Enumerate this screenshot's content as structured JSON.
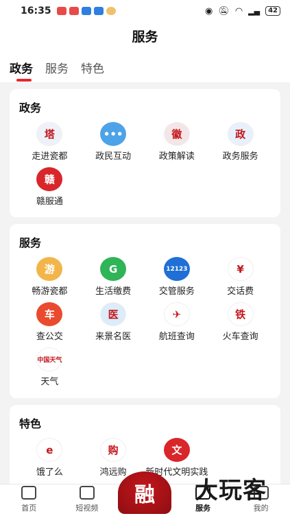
{
  "status": {
    "time": "16:35",
    "battery": "42"
  },
  "header": {
    "title": "服务"
  },
  "tabs": [
    "政务",
    "服务",
    "特色"
  ],
  "sections": {
    "gov": {
      "title": "政务",
      "items": [
        {
          "label": "走进瓷都",
          "icon": "pagoda-icon",
          "color": "#eef2f8",
          "glyph": "塔"
        },
        {
          "label": "政民互动",
          "icon": "chat-bubble-icon",
          "color": "#4ea3e8",
          "glyph": "•••"
        },
        {
          "label": "政策解读",
          "icon": "emblem-icon",
          "color": "#f4e6e6",
          "glyph": "徽"
        },
        {
          "label": "政务服务",
          "icon": "gov-service-icon",
          "color": "#e8f1fb",
          "glyph": "政"
        },
        {
          "label": "赣服通",
          "icon": "gan-fu-tong-icon",
          "color": "#d8262a",
          "glyph": "赣"
        }
      ]
    },
    "service": {
      "title": "服务",
      "items": [
        {
          "label": "畅游瓷都",
          "icon": "tower-icon",
          "color": "#f2b54a",
          "glyph": "游"
        },
        {
          "label": "生活缴费",
          "icon": "payment-icon",
          "color": "#2fb457",
          "glyph": "G"
        },
        {
          "label": "交管服务",
          "icon": "traffic-12123-icon",
          "color": "#1f6fd6",
          "glyph": "12123"
        },
        {
          "label": "交话费",
          "icon": "phone-bill-icon",
          "color": "#ffffff",
          "glyph": "¥"
        },
        {
          "label": "查公交",
          "icon": "bus-icon",
          "color": "#ea4a2e",
          "glyph": "车"
        },
        {
          "label": "来景名医",
          "icon": "doctor-icon",
          "color": "#dcecf8",
          "glyph": "医"
        },
        {
          "label": "航班查询",
          "icon": "airline-icon",
          "color": "#ffffff",
          "glyph": "✈"
        },
        {
          "label": "火车查询",
          "icon": "railway-icon",
          "color": "#ffffff",
          "glyph": "铁"
        },
        {
          "label": "天气",
          "icon": "weather-icon",
          "color": "#ffffff",
          "glyph": "中国天气"
        }
      ]
    },
    "special": {
      "title": "特色",
      "items": [
        {
          "label": "饿了么",
          "icon": "eleme-icon",
          "color": "#ffffff",
          "glyph": "e"
        },
        {
          "label": "鸿远购",
          "icon": "hongyuan-icon",
          "color": "#ffffff",
          "glyph": "购"
        },
        {
          "label": "新时代文明实践",
          "icon": "civilization-icon",
          "color": "#d8262a",
          "glyph": "文"
        }
      ]
    }
  },
  "tabbar": {
    "items": [
      "首页",
      "短视频",
      "服务",
      "我的"
    ],
    "center_logo": "融"
  },
  "watermark": "大玩客"
}
